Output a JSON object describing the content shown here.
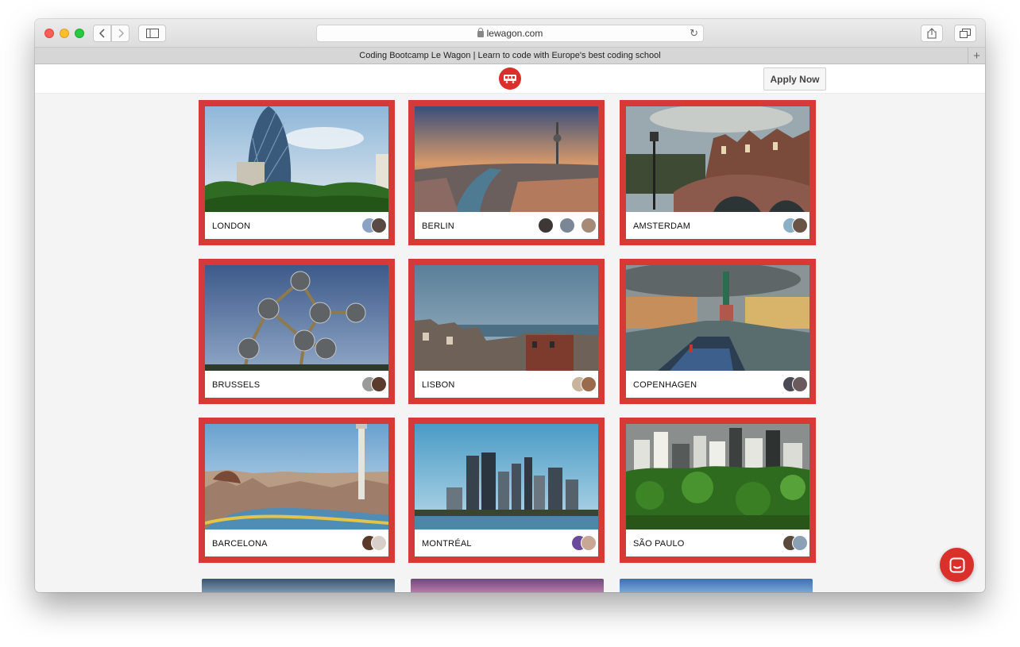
{
  "browser": {
    "url": "lewagon.com",
    "tab_title": "Coding Bootcamp Le Wagon | Learn to code with Europe's best coding school",
    "newtab_symbol": "+"
  },
  "header": {
    "logo": "le-wagon-logo",
    "apply_label": "Apply Now"
  },
  "cities": [
    {
      "name": "LONDON",
      "avatars": 2
    },
    {
      "name": "BERLIN",
      "avatars": 3
    },
    {
      "name": "AMSTERDAM",
      "avatars": 2
    },
    {
      "name": "BRUSSELS",
      "avatars": 2
    },
    {
      "name": "LISBON",
      "avatars": 2
    },
    {
      "name": "COPENHAGEN",
      "avatars": 2
    },
    {
      "name": "BARCELONA",
      "avatars": 2
    },
    {
      "name": "MONTRÉAL",
      "avatars": 2
    },
    {
      "name": "SÃO PAULO",
      "avatars": 2
    }
  ],
  "colors": {
    "brand_red": "#d63a36",
    "page_bg": "#f4f4f4"
  }
}
